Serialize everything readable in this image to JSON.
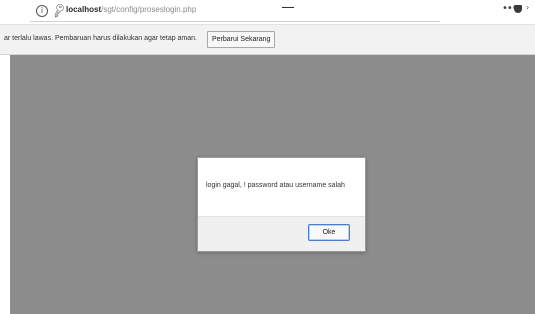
{
  "browser": {
    "url_host": "localhost",
    "url_path": "/sgt/config/proseslogin.php",
    "icons": [
      "info-icon",
      "key-icon",
      "more-icon",
      "shield-icon",
      "chevron-icon"
    ]
  },
  "notification": {
    "text": "ar terlalu lawas. Pembaruan harus dilakukan agar tetap aman.",
    "button_label": "Perbarui Sekarang"
  },
  "dialog": {
    "message": "login gagal, ! password atau username salah",
    "ok_label": "Oke"
  },
  "colors": {
    "overlay": "#8d8d8d",
    "focus_border": "#4a7fd0"
  }
}
